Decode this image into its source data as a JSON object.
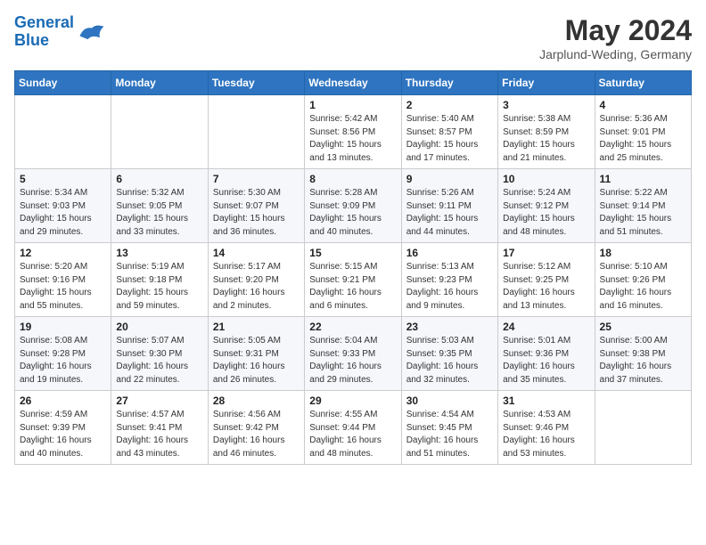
{
  "logo": {
    "line1": "General",
    "line2": "Blue"
  },
  "calendar": {
    "title": "May 2024",
    "subtitle": "Jarplund-Weding, Germany",
    "headers": [
      "Sunday",
      "Monday",
      "Tuesday",
      "Wednesday",
      "Thursday",
      "Friday",
      "Saturday"
    ],
    "rows": [
      [
        {
          "day": "",
          "sunrise": "",
          "sunset": "",
          "daylight": ""
        },
        {
          "day": "",
          "sunrise": "",
          "sunset": "",
          "daylight": ""
        },
        {
          "day": "",
          "sunrise": "",
          "sunset": "",
          "daylight": ""
        },
        {
          "day": "1",
          "sunrise": "Sunrise: 5:42 AM",
          "sunset": "Sunset: 8:56 PM",
          "daylight": "Daylight: 15 hours and 13 minutes."
        },
        {
          "day": "2",
          "sunrise": "Sunrise: 5:40 AM",
          "sunset": "Sunset: 8:57 PM",
          "daylight": "Daylight: 15 hours and 17 minutes."
        },
        {
          "day": "3",
          "sunrise": "Sunrise: 5:38 AM",
          "sunset": "Sunset: 8:59 PM",
          "daylight": "Daylight: 15 hours and 21 minutes."
        },
        {
          "day": "4",
          "sunrise": "Sunrise: 5:36 AM",
          "sunset": "Sunset: 9:01 PM",
          "daylight": "Daylight: 15 hours and 25 minutes."
        }
      ],
      [
        {
          "day": "5",
          "sunrise": "Sunrise: 5:34 AM",
          "sunset": "Sunset: 9:03 PM",
          "daylight": "Daylight: 15 hours and 29 minutes."
        },
        {
          "day": "6",
          "sunrise": "Sunrise: 5:32 AM",
          "sunset": "Sunset: 9:05 PM",
          "daylight": "Daylight: 15 hours and 33 minutes."
        },
        {
          "day": "7",
          "sunrise": "Sunrise: 5:30 AM",
          "sunset": "Sunset: 9:07 PM",
          "daylight": "Daylight: 15 hours and 36 minutes."
        },
        {
          "day": "8",
          "sunrise": "Sunrise: 5:28 AM",
          "sunset": "Sunset: 9:09 PM",
          "daylight": "Daylight: 15 hours and 40 minutes."
        },
        {
          "day": "9",
          "sunrise": "Sunrise: 5:26 AM",
          "sunset": "Sunset: 9:11 PM",
          "daylight": "Daylight: 15 hours and 44 minutes."
        },
        {
          "day": "10",
          "sunrise": "Sunrise: 5:24 AM",
          "sunset": "Sunset: 9:12 PM",
          "daylight": "Daylight: 15 hours and 48 minutes."
        },
        {
          "day": "11",
          "sunrise": "Sunrise: 5:22 AM",
          "sunset": "Sunset: 9:14 PM",
          "daylight": "Daylight: 15 hours and 51 minutes."
        }
      ],
      [
        {
          "day": "12",
          "sunrise": "Sunrise: 5:20 AM",
          "sunset": "Sunset: 9:16 PM",
          "daylight": "Daylight: 15 hours and 55 minutes."
        },
        {
          "day": "13",
          "sunrise": "Sunrise: 5:19 AM",
          "sunset": "Sunset: 9:18 PM",
          "daylight": "Daylight: 15 hours and 59 minutes."
        },
        {
          "day": "14",
          "sunrise": "Sunrise: 5:17 AM",
          "sunset": "Sunset: 9:20 PM",
          "daylight": "Daylight: 16 hours and 2 minutes."
        },
        {
          "day": "15",
          "sunrise": "Sunrise: 5:15 AM",
          "sunset": "Sunset: 9:21 PM",
          "daylight": "Daylight: 16 hours and 6 minutes."
        },
        {
          "day": "16",
          "sunrise": "Sunrise: 5:13 AM",
          "sunset": "Sunset: 9:23 PM",
          "daylight": "Daylight: 16 hours and 9 minutes."
        },
        {
          "day": "17",
          "sunrise": "Sunrise: 5:12 AM",
          "sunset": "Sunset: 9:25 PM",
          "daylight": "Daylight: 16 hours and 13 minutes."
        },
        {
          "day": "18",
          "sunrise": "Sunrise: 5:10 AM",
          "sunset": "Sunset: 9:26 PM",
          "daylight": "Daylight: 16 hours and 16 minutes."
        }
      ],
      [
        {
          "day": "19",
          "sunrise": "Sunrise: 5:08 AM",
          "sunset": "Sunset: 9:28 PM",
          "daylight": "Daylight: 16 hours and 19 minutes."
        },
        {
          "day": "20",
          "sunrise": "Sunrise: 5:07 AM",
          "sunset": "Sunset: 9:30 PM",
          "daylight": "Daylight: 16 hours and 22 minutes."
        },
        {
          "day": "21",
          "sunrise": "Sunrise: 5:05 AM",
          "sunset": "Sunset: 9:31 PM",
          "daylight": "Daylight: 16 hours and 26 minutes."
        },
        {
          "day": "22",
          "sunrise": "Sunrise: 5:04 AM",
          "sunset": "Sunset: 9:33 PM",
          "daylight": "Daylight: 16 hours and 29 minutes."
        },
        {
          "day": "23",
          "sunrise": "Sunrise: 5:03 AM",
          "sunset": "Sunset: 9:35 PM",
          "daylight": "Daylight: 16 hours and 32 minutes."
        },
        {
          "day": "24",
          "sunrise": "Sunrise: 5:01 AM",
          "sunset": "Sunset: 9:36 PM",
          "daylight": "Daylight: 16 hours and 35 minutes."
        },
        {
          "day": "25",
          "sunrise": "Sunrise: 5:00 AM",
          "sunset": "Sunset: 9:38 PM",
          "daylight": "Daylight: 16 hours and 37 minutes."
        }
      ],
      [
        {
          "day": "26",
          "sunrise": "Sunrise: 4:59 AM",
          "sunset": "Sunset: 9:39 PM",
          "daylight": "Daylight: 16 hours and 40 minutes."
        },
        {
          "day": "27",
          "sunrise": "Sunrise: 4:57 AM",
          "sunset": "Sunset: 9:41 PM",
          "daylight": "Daylight: 16 hours and 43 minutes."
        },
        {
          "day": "28",
          "sunrise": "Sunrise: 4:56 AM",
          "sunset": "Sunset: 9:42 PM",
          "daylight": "Daylight: 16 hours and 46 minutes."
        },
        {
          "day": "29",
          "sunrise": "Sunrise: 4:55 AM",
          "sunset": "Sunset: 9:44 PM",
          "daylight": "Daylight: 16 hours and 48 minutes."
        },
        {
          "day": "30",
          "sunrise": "Sunrise: 4:54 AM",
          "sunset": "Sunset: 9:45 PM",
          "daylight": "Daylight: 16 hours and 51 minutes."
        },
        {
          "day": "31",
          "sunrise": "Sunrise: 4:53 AM",
          "sunset": "Sunset: 9:46 PM",
          "daylight": "Daylight: 16 hours and 53 minutes."
        },
        {
          "day": "",
          "sunrise": "",
          "sunset": "",
          "daylight": ""
        }
      ]
    ]
  }
}
